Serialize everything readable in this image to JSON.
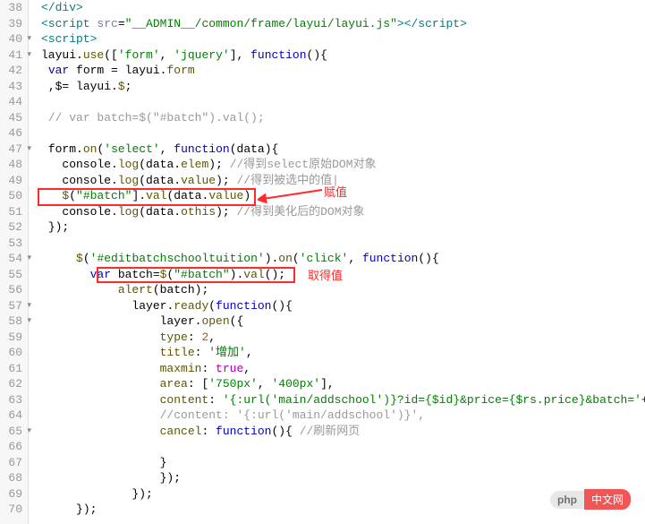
{
  "editor": {
    "first_line_number": 38,
    "lines": [
      {
        "indent": "",
        "fold": false,
        "tokens": [
          [
            "tag",
            "</div>"
          ]
        ]
      },
      {
        "indent": "",
        "fold": false,
        "tokens": [
          [
            "tag",
            "<script "
          ],
          [
            "attr",
            "src"
          ],
          [
            "punct",
            "="
          ],
          [
            "str",
            "\"__ADMIN__/common/frame/layui/layui.js\""
          ],
          [
            "tag",
            "></script>"
          ]
        ]
      },
      {
        "indent": "",
        "fold": true,
        "tokens": [
          [
            "tag",
            "<script>"
          ]
        ]
      },
      {
        "indent": "",
        "fold": true,
        "tokens": [
          [
            "ident",
            "layui"
          ],
          [
            "punct",
            "."
          ],
          [
            "prop",
            "use"
          ],
          [
            "punct",
            "(["
          ],
          [
            "str",
            "'form'"
          ],
          [
            "punct",
            ", "
          ],
          [
            "str",
            "'jquery'"
          ],
          [
            "punct",
            "], "
          ],
          [
            "kw",
            "function"
          ],
          [
            "punct",
            "(){"
          ]
        ]
      },
      {
        "indent": " ",
        "fold": false,
        "tokens": [
          [
            "kw",
            "var"
          ],
          [
            "ident",
            " form "
          ],
          [
            "punct",
            "= "
          ],
          [
            "ident",
            "layui"
          ],
          [
            "punct",
            "."
          ],
          [
            "prop",
            "form"
          ]
        ]
      },
      {
        "indent": " ",
        "fold": false,
        "tokens": [
          [
            "punct",
            ",$= "
          ],
          [
            "ident",
            "layui"
          ],
          [
            "punct",
            "."
          ],
          [
            "prop",
            "$"
          ],
          [
            "punct",
            ";"
          ]
        ]
      },
      {
        "indent": "",
        "fold": false,
        "tokens": []
      },
      {
        "indent": " ",
        "fold": false,
        "tokens": [
          [
            "cmt",
            "// var batch=$(\"#batch\").val();"
          ]
        ]
      },
      {
        "indent": "",
        "fold": false,
        "tokens": []
      },
      {
        "indent": " ",
        "fold": true,
        "tokens": [
          [
            "ident",
            "form"
          ],
          [
            "punct",
            "."
          ],
          [
            "prop",
            "on"
          ],
          [
            "punct",
            "("
          ],
          [
            "str",
            "'select'"
          ],
          [
            "punct",
            ", "
          ],
          [
            "kw",
            "function"
          ],
          [
            "punct",
            "("
          ],
          [
            "ident",
            "data"
          ],
          [
            "punct",
            "){"
          ]
        ]
      },
      {
        "indent": "   ",
        "fold": false,
        "tokens": [
          [
            "ident",
            "console"
          ],
          [
            "punct",
            "."
          ],
          [
            "prop",
            "log"
          ],
          [
            "punct",
            "("
          ],
          [
            "ident",
            "data"
          ],
          [
            "punct",
            "."
          ],
          [
            "prop",
            "elem"
          ],
          [
            "punct",
            "); "
          ],
          [
            "cmt",
            "//得到select原始DOM对象"
          ]
        ]
      },
      {
        "indent": "   ",
        "fold": false,
        "tokens": [
          [
            "ident",
            "console"
          ],
          [
            "punct",
            "."
          ],
          [
            "prop",
            "log"
          ],
          [
            "punct",
            "("
          ],
          [
            "ident",
            "data"
          ],
          [
            "punct",
            "."
          ],
          [
            "prop",
            "value"
          ],
          [
            "punct",
            "); "
          ],
          [
            "cmt",
            "//得到被选中的值|"
          ]
        ]
      },
      {
        "indent": "   ",
        "fold": false,
        "tokens": [
          [
            "fn",
            "$"
          ],
          [
            "punct",
            "("
          ],
          [
            "str",
            "\"#batch\""
          ],
          [
            "punct",
            "]."
          ],
          [
            "prop",
            "val"
          ],
          [
            "punct",
            "("
          ],
          [
            "ident",
            "data"
          ],
          [
            "punct",
            "."
          ],
          [
            "prop",
            "value"
          ],
          [
            "punct",
            ")"
          ]
        ]
      },
      {
        "indent": "   ",
        "fold": false,
        "tokens": [
          [
            "ident",
            "console"
          ],
          [
            "punct",
            "."
          ],
          [
            "prop",
            "log"
          ],
          [
            "punct",
            "("
          ],
          [
            "ident",
            "data"
          ],
          [
            "punct",
            "."
          ],
          [
            "prop",
            "othis"
          ],
          [
            "punct",
            "); "
          ],
          [
            "cmt",
            "//得到美化后的DOM对象"
          ]
        ]
      },
      {
        "indent": " ",
        "fold": false,
        "tokens": [
          [
            "punct",
            "});"
          ]
        ]
      },
      {
        "indent": "",
        "fold": false,
        "tokens": []
      },
      {
        "indent": "     ",
        "fold": true,
        "tokens": [
          [
            "fn",
            "$"
          ],
          [
            "punct",
            "("
          ],
          [
            "str",
            "'#editbatchschooltuition'"
          ],
          [
            "punct",
            ")."
          ],
          [
            "prop",
            "on"
          ],
          [
            "punct",
            "("
          ],
          [
            "str",
            "'click'"
          ],
          [
            "punct",
            ", "
          ],
          [
            "kw",
            "function"
          ],
          [
            "punct",
            "(){"
          ]
        ]
      },
      {
        "indent": "       ",
        "fold": false,
        "tokens": [
          [
            "kw",
            "var"
          ],
          [
            "ident",
            " batch="
          ],
          [
            "fn",
            "$"
          ],
          [
            "punct",
            "("
          ],
          [
            "str",
            "\"#batch\""
          ],
          [
            "punct",
            ")."
          ],
          [
            "prop",
            "val"
          ],
          [
            "punct",
            "();"
          ]
        ]
      },
      {
        "indent": "       ",
        "fold": false,
        "tokens": [
          [
            "fn",
            "    alert"
          ],
          [
            "punct",
            "("
          ],
          [
            "ident",
            "batch"
          ],
          [
            "punct",
            ");"
          ]
        ]
      },
      {
        "indent": "         ",
        "fold": true,
        "tokens": [
          [
            "ident",
            "    layer"
          ],
          [
            "punct",
            "."
          ],
          [
            "prop",
            "ready"
          ],
          [
            "punct",
            "("
          ],
          [
            "kw",
            "function"
          ],
          [
            "punct",
            "(){"
          ]
        ]
      },
      {
        "indent": "             ",
        "fold": true,
        "tokens": [
          [
            "ident",
            "    layer"
          ],
          [
            "punct",
            "."
          ],
          [
            "prop",
            "open"
          ],
          [
            "punct",
            "({"
          ]
        ]
      },
      {
        "indent": "                 ",
        "fold": false,
        "tokens": [
          [
            "prop",
            "type"
          ],
          [
            "punct",
            ": "
          ],
          [
            "num",
            "2"
          ],
          [
            "punct",
            ","
          ]
        ]
      },
      {
        "indent": "                 ",
        "fold": false,
        "tokens": [
          [
            "prop",
            "title"
          ],
          [
            "punct",
            ": "
          ],
          [
            "str",
            "'增加'"
          ],
          [
            "punct",
            ","
          ]
        ]
      },
      {
        "indent": "                 ",
        "fold": false,
        "tokens": [
          [
            "prop",
            "maxmin"
          ],
          [
            "punct",
            ": "
          ],
          [
            "bool",
            "true"
          ],
          [
            "punct",
            ","
          ]
        ]
      },
      {
        "indent": "                 ",
        "fold": false,
        "tokens": [
          [
            "prop",
            "area"
          ],
          [
            "punct",
            ": ["
          ],
          [
            "str",
            "'750px'"
          ],
          [
            "punct",
            ", "
          ],
          [
            "str",
            "'400px'"
          ],
          [
            "punct",
            "],"
          ]
        ]
      },
      {
        "indent": "                 ",
        "fold": false,
        "tokens": [
          [
            "prop",
            "content"
          ],
          [
            "punct",
            ": "
          ],
          [
            "str",
            "'{:url('main/addschool')}?id={$id}&price={$rs.price}&batch='"
          ],
          [
            "punct",
            "+batc"
          ]
        ]
      },
      {
        "indent": "                 ",
        "fold": false,
        "tokens": [
          [
            "cmt",
            "//content: '{:url('main/addschool')}',"
          ]
        ]
      },
      {
        "indent": "                 ",
        "fold": true,
        "tokens": [
          [
            "prop",
            "cancel"
          ],
          [
            "punct",
            ": "
          ],
          [
            "kw",
            "function"
          ],
          [
            "punct",
            "(){ "
          ],
          [
            "cmt",
            "//刷新网页"
          ]
        ]
      },
      {
        "indent": "",
        "fold": false,
        "tokens": []
      },
      {
        "indent": "                 ",
        "fold": false,
        "tokens": [
          [
            "punct",
            "}"
          ]
        ]
      },
      {
        "indent": "             ",
        "fold": false,
        "tokens": [
          [
            "punct",
            "    });"
          ]
        ]
      },
      {
        "indent": "         ",
        "fold": false,
        "tokens": [
          [
            "punct",
            "    });"
          ]
        ]
      },
      {
        "indent": "     ",
        "fold": false,
        "tokens": [
          [
            "punct",
            "});"
          ]
        ]
      }
    ]
  },
  "annotations": {
    "label1": "赋值",
    "label2": "取得值"
  },
  "watermark": {
    "left": "php",
    "right": "中文网"
  }
}
